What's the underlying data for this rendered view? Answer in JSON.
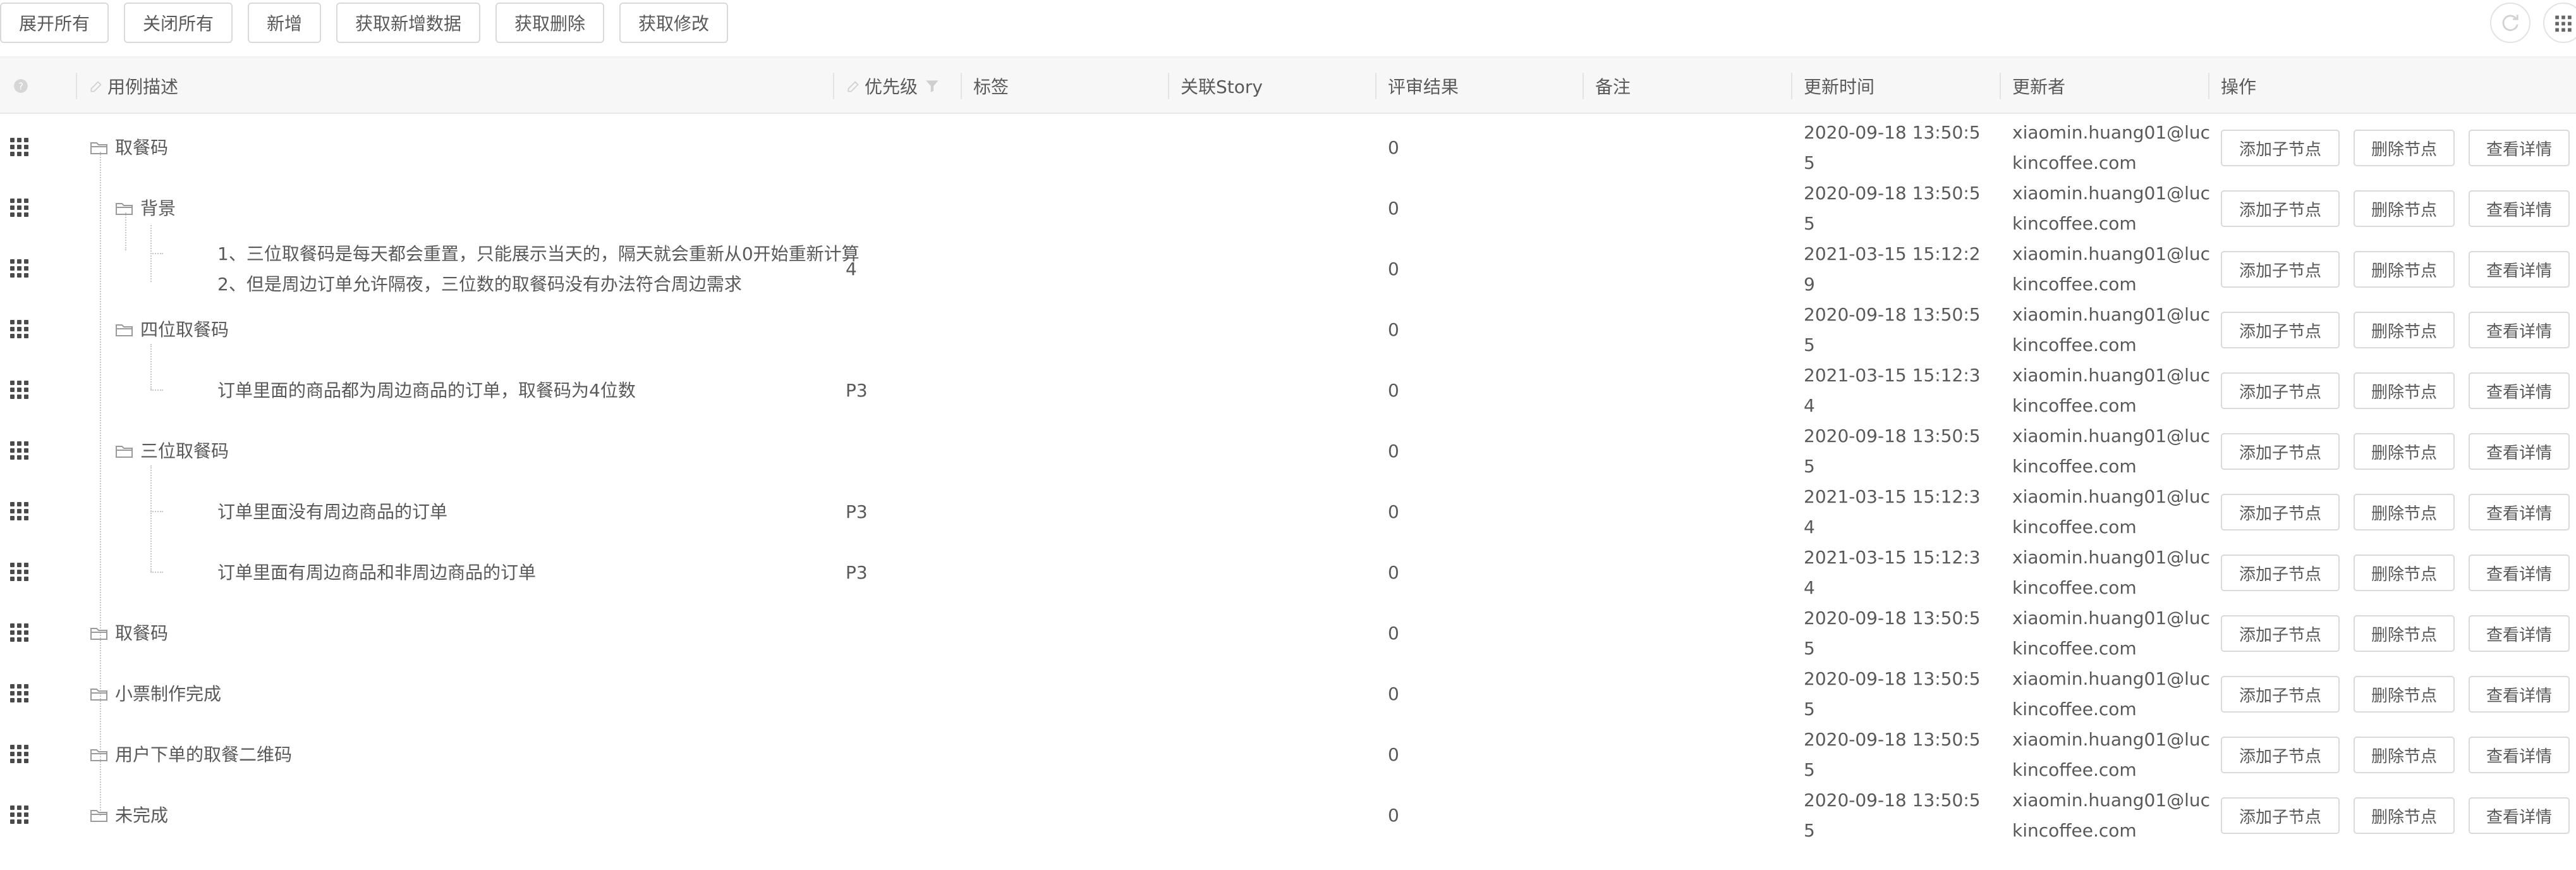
{
  "toolbar": {
    "expand_all": "展开所有",
    "collapse_all": "关闭所有",
    "add": "新增",
    "get_new_data": "获取新增数据",
    "get_deleted": "获取删除",
    "get_modified": "获取修改"
  },
  "columns": {
    "description": "用例描述",
    "priority": "优先级",
    "tags": "标签",
    "story": "关联Story",
    "review_result": "评审结果",
    "remark": "备注",
    "updated_time": "更新时间",
    "updater": "更新者",
    "actions": "操作"
  },
  "action_labels": {
    "add_child": "添加子节点",
    "delete": "删除节点",
    "view": "查看详情"
  },
  "rows": [
    {
      "desc": "取餐码",
      "priority": "",
      "review": "0",
      "time1": "2020-09-18 13:50:5",
      "time2": "5",
      "user1": "xiaomin.huang01@luc",
      "user2": "kincoffee.com"
    },
    {
      "desc": "背景",
      "priority": "",
      "review": "0",
      "time1": "2020-09-18 13:50:5",
      "time2": "5",
      "user1": "xiaomin.huang01@luc",
      "user2": "kincoffee.com"
    },
    {
      "desc": "1、三位取餐码是每天都会重置，只能展示当天的，隔天就会重新从0开始重新计算",
      "desc2": "2、但是周边订单允许隔夜，三位数的取餐码没有办法符合周边需求",
      "priority": "4",
      "review": "0",
      "time1": "2021-03-15 15:12:2",
      "time2": "9",
      "user1": "xiaomin.huang01@luc",
      "user2": "kincoffee.com"
    },
    {
      "desc": "四位取餐码",
      "priority": "",
      "review": "0",
      "time1": "2020-09-18 13:50:5",
      "time2": "5",
      "user1": "xiaomin.huang01@luc",
      "user2": "kincoffee.com"
    },
    {
      "desc": "订单里面的商品都为周边商品的订单，取餐码为4位数",
      "priority": "P3",
      "review": "0",
      "time1": "2021-03-15 15:12:3",
      "time2": "4",
      "user1": "xiaomin.huang01@luc",
      "user2": "kincoffee.com"
    },
    {
      "desc": "三位取餐码",
      "priority": "",
      "review": "0",
      "time1": "2020-09-18 13:50:5",
      "time2": "5",
      "user1": "xiaomin.huang01@luc",
      "user2": "kincoffee.com"
    },
    {
      "desc": "订单里面没有周边商品的订单",
      "priority": "P3",
      "review": "0",
      "time1": "2021-03-15 15:12:3",
      "time2": "4",
      "user1": "xiaomin.huang01@luc",
      "user2": "kincoffee.com"
    },
    {
      "desc": "订单里面有周边商品和非周边商品的订单",
      "priority": "P3",
      "review": "0",
      "time1": "2021-03-15 15:12:3",
      "time2": "4",
      "user1": "xiaomin.huang01@luc",
      "user2": "kincoffee.com"
    },
    {
      "desc": "取餐码",
      "priority": "",
      "review": "0",
      "time1": "2020-09-18 13:50:5",
      "time2": "5",
      "user1": "xiaomin.huang01@luc",
      "user2": "kincoffee.com"
    },
    {
      "desc": "小票制作完成",
      "priority": "",
      "review": "0",
      "time1": "2020-09-18 13:50:5",
      "time2": "5",
      "user1": "xiaomin.huang01@luc",
      "user2": "kincoffee.com"
    },
    {
      "desc": "用户下单的取餐二维码",
      "priority": "",
      "review": "0",
      "time1": "2020-09-18 13:50:5",
      "time2": "5",
      "user1": "xiaomin.huang01@luc",
      "user2": "kincoffee.com"
    },
    {
      "desc": "未完成",
      "priority": "",
      "review": "0",
      "time1": "2020-09-18 13:50:5",
      "time2": "5",
      "user1": "xiaomin.huang01@luc",
      "user2": "kincoffee.com"
    }
  ]
}
